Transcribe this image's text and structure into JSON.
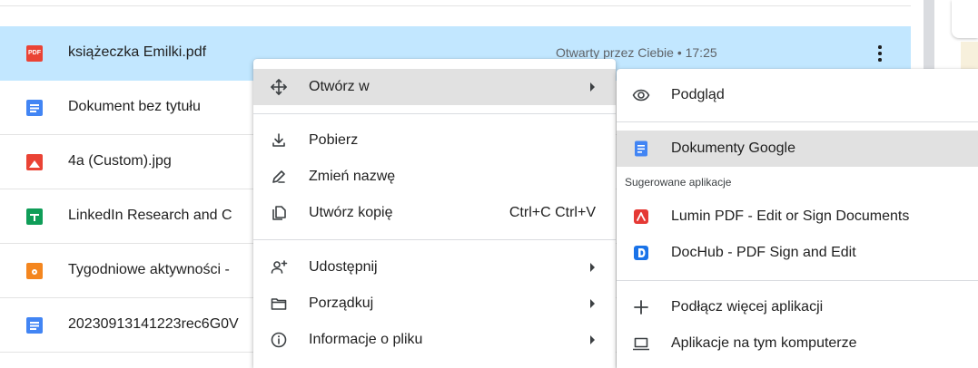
{
  "files": [
    {
      "name": "",
      "meta": "",
      "type": "doc"
    },
    {
      "name": "książeczka Emilki.pdf",
      "meta": "Otwarty przez Ciebie • 17:25",
      "type": "pdf",
      "icon_text": "PDF"
    },
    {
      "name": "Dokument bez tytułu",
      "type": "doc"
    },
    {
      "name": "4a (Custom).jpg",
      "type": "image"
    },
    {
      "name": "LinkedIn Research and C",
      "type": "sheet"
    },
    {
      "name": "Tygodniowe aktywności -",
      "type": "form"
    },
    {
      "name": "20230913141223rec6G0V",
      "type": "doc"
    }
  ],
  "menu": {
    "open_with": "Otwórz w",
    "download": "Pobierz",
    "rename": "Zmień nazwę",
    "copy": "Utwórz kopię",
    "copy_shortcut": "Ctrl+C Ctrl+V",
    "share": "Udostępnij",
    "organize": "Porządkuj",
    "file_info": "Informacje o pliku"
  },
  "submenu": {
    "preview": "Podgląd",
    "google_docs": "Dokumenty Google",
    "suggested_header": "Sugerowane aplikacje",
    "apps": [
      "Lumin PDF - Edit or Sign Documents",
      "DocHub - PDF Sign and Edit"
    ],
    "connect_more": "Podłącz więcej aplikacji",
    "computer_apps": "Aplikacje na tym komputerze"
  },
  "colors": {
    "selected_row": "#c2e7ff",
    "menu_highlight": "#e1e1e1",
    "docs_blue": "#4285f4",
    "pdf_red": "#ea4335",
    "sheets_green": "#0f9d58",
    "forms_orange": "#f4861f",
    "dochub_blue": "#1a73e8"
  }
}
